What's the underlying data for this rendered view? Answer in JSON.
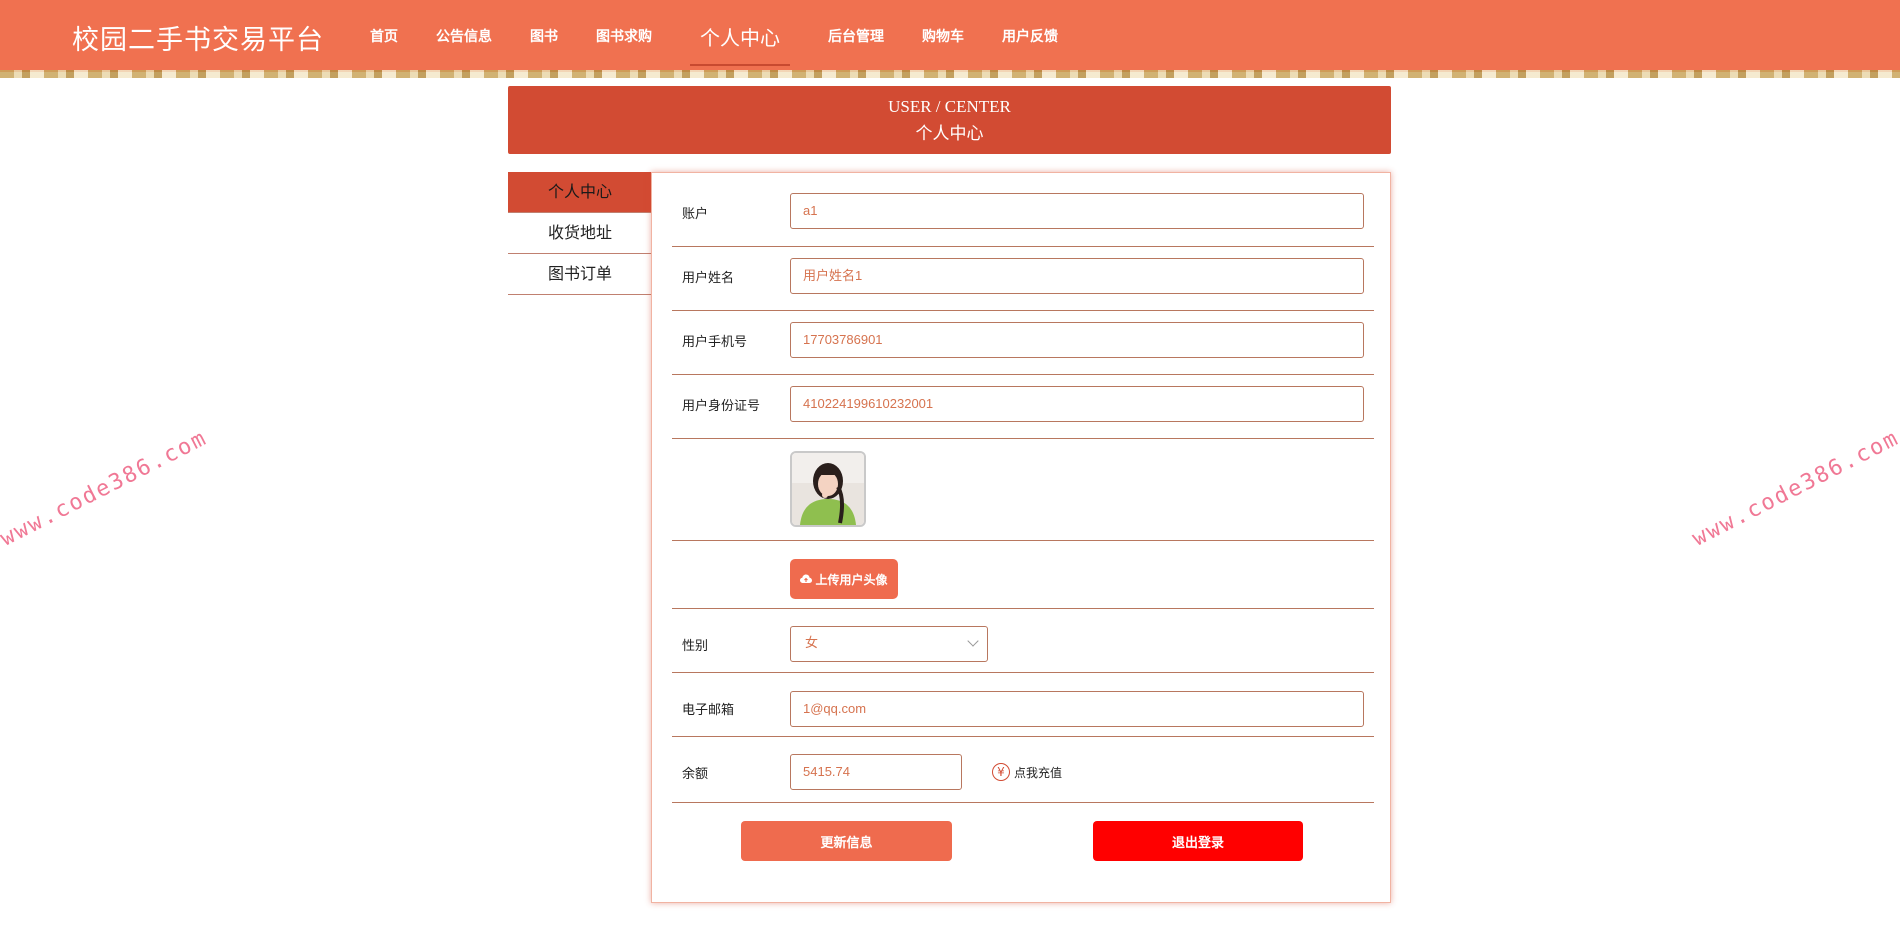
{
  "app": {
    "title": "校园二手书交易平台"
  },
  "nav": {
    "items": [
      {
        "label": "首页"
      },
      {
        "label": "公告信息"
      },
      {
        "label": "图书"
      },
      {
        "label": "图书求购"
      },
      {
        "label": "个人中心"
      },
      {
        "label": "后台管理"
      },
      {
        "label": "购物车"
      },
      {
        "label": "用户反馈"
      }
    ],
    "active": "个人中心"
  },
  "watermark": "www.code386.com",
  "banner": {
    "en": "USER / CENTER",
    "cn": "个人中心"
  },
  "sidebar": {
    "items": [
      {
        "label": "个人中心"
      },
      {
        "label": "收货地址"
      },
      {
        "label": "图书订单"
      }
    ]
  },
  "form": {
    "account": {
      "label": "账户",
      "value": "a1"
    },
    "name": {
      "label": "用户姓名",
      "value": "用户姓名1"
    },
    "phone": {
      "label": "用户手机号",
      "value": "17703786901"
    },
    "idcard": {
      "label": "用户身份证号",
      "value": "410224199610232001"
    },
    "avatar": {
      "icon": "user-avatar-photo"
    },
    "upload": {
      "label": "上传用户头像",
      "icon": "cloud-upload-icon"
    },
    "gender": {
      "label": "性别",
      "value": "女"
    },
    "email": {
      "label": "电子邮箱",
      "value": "1@qq.com"
    },
    "balance": {
      "label": "余额",
      "value": "5415.74",
      "recharge_label": "点我充值",
      "recharge_icon": "¥"
    }
  },
  "buttons": {
    "update": "更新信息",
    "logout": "退出登录"
  },
  "colors": {
    "primary": "#f07150",
    "banner": "#d24b33",
    "logout": "#ff0000"
  }
}
